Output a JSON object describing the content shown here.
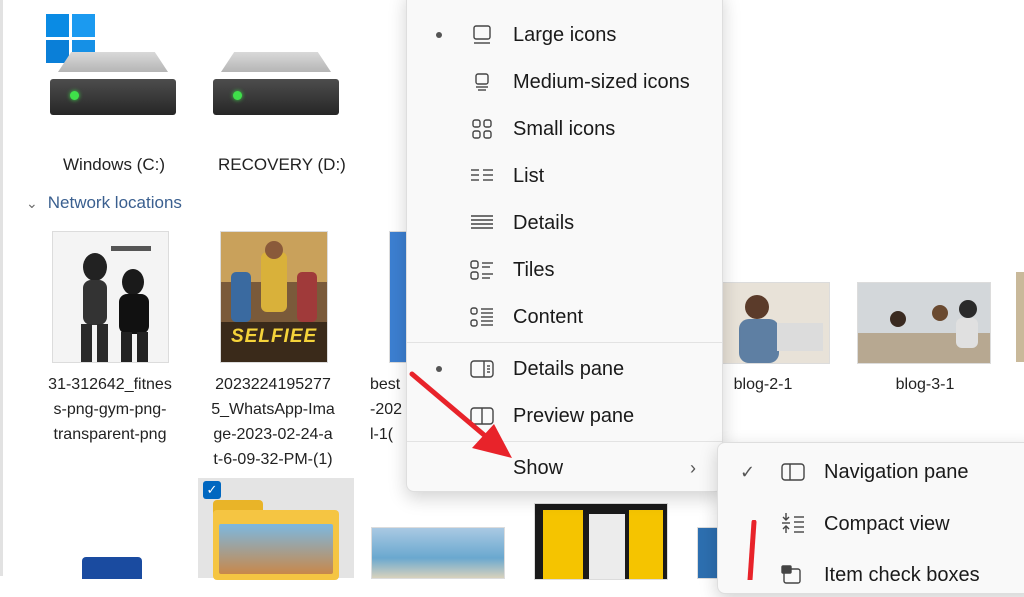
{
  "drives": [
    {
      "label": "Windows (C:)"
    },
    {
      "label": "RECOVERY (D:)"
    }
  ],
  "network_header": "Network locations",
  "files": [
    {
      "label": "31-312642_fitnes\ns-png-gym-png-\ntransparent-png"
    },
    {
      "label": "2023224195277\n5_WhatsApp-Ima\nge-2023-02-24-a\nt-6-09-32-PM-(1)"
    },
    {
      "label": "best\n-202\nl-1("
    },
    {
      "label": "blog-2-1"
    },
    {
      "label": "blog-3-1"
    }
  ],
  "poster_text": "SELFIEE",
  "view_menu": {
    "items": [
      {
        "label": "Large icons",
        "icon": "large-icons-icon",
        "selected": true
      },
      {
        "label": "Medium-sized icons",
        "icon": "medium-icons-icon",
        "selected": false
      },
      {
        "label": "Small icons",
        "icon": "small-icons-icon",
        "selected": false
      },
      {
        "label": "List",
        "icon": "list-icon",
        "selected": false
      },
      {
        "label": "Details",
        "icon": "details-icon",
        "selected": false
      },
      {
        "label": "Tiles",
        "icon": "tiles-icon",
        "selected": false
      },
      {
        "label": "Content",
        "icon": "content-icon",
        "selected": false
      }
    ],
    "panes": [
      {
        "label": "Details pane",
        "icon": "details-pane-icon",
        "selected": true
      },
      {
        "label": "Preview pane",
        "icon": "preview-pane-icon",
        "selected": false
      }
    ],
    "show_label": "Show"
  },
  "show_submenu": {
    "items": [
      {
        "label": "Navigation pane",
        "icon": "navigation-pane-icon",
        "checked": true
      },
      {
        "label": "Compact view",
        "icon": "compact-view-icon",
        "checked": false
      },
      {
        "label": "Item check boxes",
        "icon": "item-check-boxes-icon",
        "checked": false
      }
    ]
  },
  "colors": {
    "annotation_arrow": "#e8232a",
    "accent": "#0067c0"
  }
}
